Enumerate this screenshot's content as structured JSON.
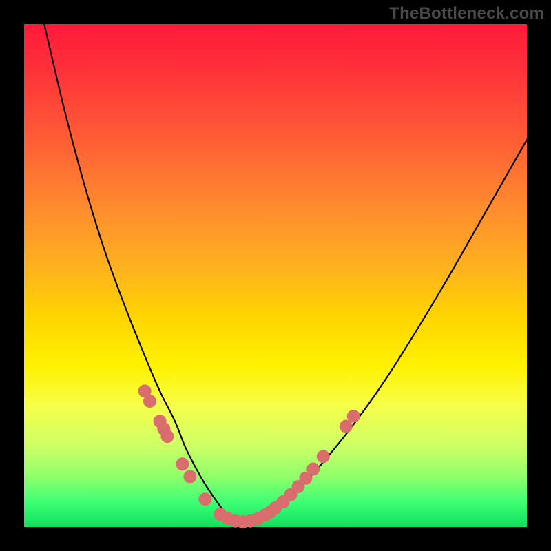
{
  "watermark": "TheBottleneck.com",
  "colors": {
    "frame": "#000000",
    "dot": "#d96c6c",
    "curve": "#000000",
    "gradient_stops": [
      "#ff1a3a",
      "#ff5a36",
      "#ffb020",
      "#fff200",
      "#ccff66",
      "#10e060"
    ]
  },
  "chart_data": {
    "type": "line",
    "title": "",
    "xlabel": "",
    "ylabel": "",
    "xlim": [
      0,
      100
    ],
    "ylim": [
      0,
      100
    ],
    "note": "Axes are unlabeled in the source; values are approximate percentages of the plot area (0,0 = top-left).",
    "series": [
      {
        "name": "curve",
        "x": [
          4,
          8,
          12,
          16,
          20,
          24,
          27,
          30,
          32,
          34,
          36,
          38,
          39.5,
          41,
          43,
          46,
          50,
          55,
          60,
          66,
          72,
          78,
          84,
          90,
          96,
          100
        ],
        "y": [
          0,
          17,
          32,
          45,
          56,
          66,
          73,
          79,
          84,
          88,
          91.5,
          94.5,
          96.5,
          98,
          98.8,
          98.2,
          96,
          92,
          86.5,
          79,
          70.5,
          61,
          51,
          40.5,
          30,
          23
        ]
      }
    ],
    "annotations": {
      "data_points_on_curve": [
        {
          "x_pct": 24.0,
          "y_pct": 73.0
        },
        {
          "x_pct": 25.0,
          "y_pct": 75.0
        },
        {
          "x_pct": 27.0,
          "y_pct": 79.0
        },
        {
          "x_pct": 27.8,
          "y_pct": 80.5
        },
        {
          "x_pct": 28.5,
          "y_pct": 82.0
        },
        {
          "x_pct": 31.5,
          "y_pct": 87.5
        },
        {
          "x_pct": 33.0,
          "y_pct": 90.0
        },
        {
          "x_pct": 36.0,
          "y_pct": 94.5
        },
        {
          "x_pct": 39.0,
          "y_pct": 97.5
        },
        {
          "x_pct": 40.5,
          "y_pct": 98.3
        },
        {
          "x_pct": 42.0,
          "y_pct": 98.8
        },
        {
          "x_pct": 43.5,
          "y_pct": 99.0
        },
        {
          "x_pct": 45.0,
          "y_pct": 98.8
        },
        {
          "x_pct": 46.5,
          "y_pct": 98.4
        },
        {
          "x_pct": 48.0,
          "y_pct": 97.6
        },
        {
          "x_pct": 49.0,
          "y_pct": 97.0
        },
        {
          "x_pct": 50.0,
          "y_pct": 96.2
        },
        {
          "x_pct": 51.5,
          "y_pct": 95.0
        },
        {
          "x_pct": 53.0,
          "y_pct": 93.6
        },
        {
          "x_pct": 54.5,
          "y_pct": 92.0
        },
        {
          "x_pct": 56.0,
          "y_pct": 90.3
        },
        {
          "x_pct": 57.5,
          "y_pct": 88.5
        },
        {
          "x_pct": 59.5,
          "y_pct": 86.0
        },
        {
          "x_pct": 64.0,
          "y_pct": 80.0
        },
        {
          "x_pct": 65.5,
          "y_pct": 78.0
        }
      ]
    }
  }
}
